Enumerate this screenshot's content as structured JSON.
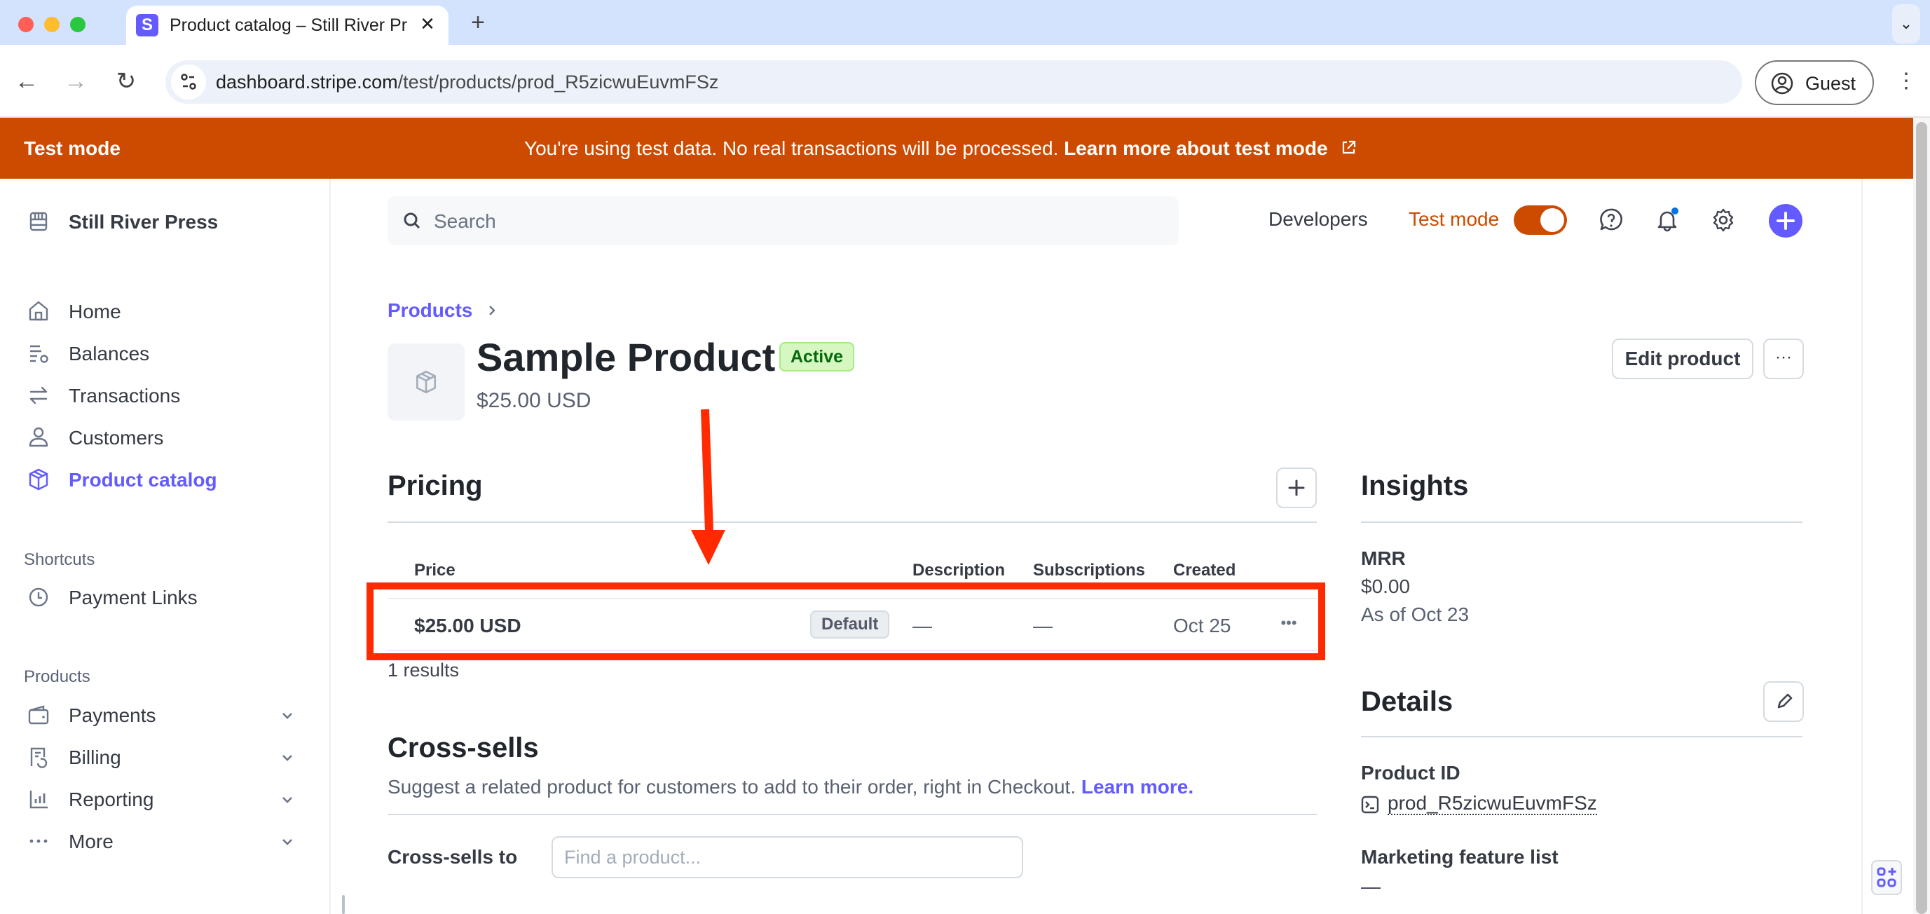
{
  "browser": {
    "tab_title": "Product catalog – Still River Press",
    "tab_favicon_letter": "S",
    "url_host": "dashboard.stripe.com",
    "url_path": "/test/products/prod_R5zicwuEuvmFSz",
    "profile_label": "Guest"
  },
  "banner": {
    "label": "Test mode",
    "message": "You're using test data. No real transactions will be processed.",
    "link": "Learn more about test mode",
    "color": "#cc4b00"
  },
  "sidebar": {
    "account_name": "Still River Press",
    "nav_items": [
      {
        "label": "Home",
        "icon": "home-icon"
      },
      {
        "label": "Balances",
        "icon": "balances-icon"
      },
      {
        "label": "Transactions",
        "icon": "transactions-icon"
      },
      {
        "label": "Customers",
        "icon": "customer-icon"
      },
      {
        "label": "Product catalog",
        "icon": "box-icon",
        "active": true
      }
    ],
    "shortcuts_heading": "Shortcuts",
    "shortcuts": [
      {
        "label": "Payment Links",
        "icon": "clock-icon"
      }
    ],
    "products_heading": "Products",
    "products": [
      {
        "label": "Payments",
        "icon": "wallet-icon"
      },
      {
        "label": "Billing",
        "icon": "billing-icon"
      },
      {
        "label": "Reporting",
        "icon": "chart-icon"
      },
      {
        "label": "More",
        "icon": "more-dots-icon"
      }
    ]
  },
  "header": {
    "search_placeholder": "Search",
    "developers": "Developers",
    "test_mode_label": "Test mode",
    "test_mode_on": true,
    "accent": "#635bff"
  },
  "product": {
    "breadcrumb": "Products",
    "name": "Sample Product",
    "status": "Active",
    "price": "$25.00 USD",
    "edit_label": "Edit product",
    "more_label": "···"
  },
  "pricing": {
    "title": "Pricing",
    "columns": [
      "Price",
      "Description",
      "Subscriptions",
      "Created"
    ],
    "rows": [
      {
        "price": "$25.00 USD",
        "badge": "Default",
        "description": "—",
        "subscriptions": "—",
        "created": "Oct 25"
      }
    ],
    "results": "1 results"
  },
  "cross_sells": {
    "title": "Cross-sells",
    "description": "Suggest a related product for customers to add to their order, right in Checkout.",
    "learn_more": "Learn more.",
    "field_label": "Cross-sells to",
    "field_placeholder": "Find a product..."
  },
  "insights": {
    "title": "Insights",
    "mrr_label": "MRR",
    "mrr_value": "$0.00",
    "mrr_asof": "As of Oct 23"
  },
  "details": {
    "title": "Details",
    "product_id_label": "Product ID",
    "product_id": "prod_R5zicwuEuvmFSz",
    "marketing_label": "Marketing feature list",
    "marketing_value": "—"
  }
}
